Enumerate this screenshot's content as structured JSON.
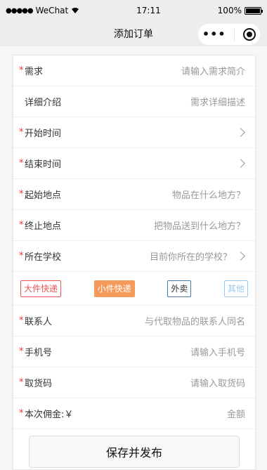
{
  "status_bar": {
    "carrier": "WeChat",
    "time": "17:11",
    "battery": "100%",
    "battery_level": 1.0
  },
  "navbar": {
    "title": "添加订单"
  },
  "form": {
    "rows": [
      {
        "required": "*",
        "label": "需求",
        "value": "请输入需求简介"
      },
      {
        "required": "",
        "label": "详细介绍",
        "value": "需求详细描述"
      },
      {
        "required": "*",
        "label": "开始时间",
        "value": ""
      },
      {
        "required": "*",
        "label": "结束时间",
        "value": ""
      },
      {
        "required": "*",
        "label": "起始地点",
        "value": "物品在什么地方？"
      },
      {
        "required": "*",
        "label": "终止地点",
        "value": "把物品送到什么地方？"
      },
      {
        "required": "*",
        "label": "所在学校",
        "value": "目前你所在的学校？"
      }
    ],
    "types": [
      "大件快递",
      "小件快递",
      "外卖",
      "其他"
    ],
    "rows2": [
      {
        "required": "*",
        "label": "联系人",
        "value": "与代取物品的联系人同名"
      },
      {
        "required": "*",
        "label": "手机号",
        "value": "请输入手机号"
      },
      {
        "required": "*",
        "label": "取货码",
        "value": "请输入取货码"
      },
      {
        "required": "*",
        "label": "本次佣金:￥",
        "value": "金额"
      }
    ],
    "save_label": "保存并发布"
  }
}
